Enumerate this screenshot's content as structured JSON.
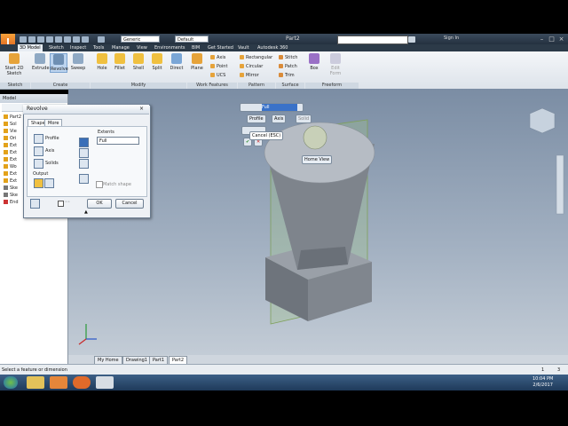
{
  "app": {
    "logo": "I",
    "doc_title": "Part2",
    "signin": "Sign In"
  },
  "quick_access": {
    "material": "Generic",
    "appearance": "Default"
  },
  "menu_tabs": [
    "3D Model",
    "Sketch",
    "Inspect",
    "Tools",
    "Manage",
    "View",
    "Environments",
    "BIM",
    "Get Started",
    "Vault",
    "Autodesk 360"
  ],
  "ribbon": {
    "start_sketch": "Start 2D Sketch",
    "create": [
      "Extrude",
      "Revolve",
      "Sweep"
    ],
    "modify": [
      "Hole",
      "Fillet",
      "Shell",
      "Split",
      "Direct"
    ],
    "plane": "Plane",
    "axis": "Axis",
    "point": "Point",
    "ucs": "UCS",
    "pattern": [
      "Rectangular",
      "Circular",
      "Mirror"
    ],
    "surface": [
      "Stitch",
      "Patch",
      "Trim"
    ],
    "box": "Box",
    "edit_form": "Edit Form",
    "panels": {
      "sketch": "Sketch",
      "create": "Create",
      "modify": "Modify",
      "work": "Work Features",
      "pattern": "Pattern",
      "surface": "Surface",
      "freeform": "Freeform"
    }
  },
  "browser": {
    "title": "Model",
    "items": [
      "Part2",
      "Sol",
      "Vie",
      "Ori",
      "Ext",
      "Ext",
      "Ext",
      "Wo",
      "Ext",
      "Ext",
      "Ske",
      "Ske",
      "End"
    ]
  },
  "dialog": {
    "title": "Revolve",
    "tabs": [
      "Shape",
      "More"
    ],
    "profile": "Profile",
    "axis": "Axis",
    "solids": "Solids",
    "output": "Output",
    "extents_label": "Extents",
    "extents_value": "Full",
    "match_shape": "Match shape",
    "ok": "OK",
    "cancel": "Cancel"
  },
  "minitoolbar": {
    "full": "Full",
    "profile": "Profile",
    "axis": "Axis",
    "solid": "Solid",
    "cancel": "Cancel (ESC)",
    "home": "Home View"
  },
  "doc_tabs": [
    "My Home",
    "Drawing1",
    "Part1",
    "Part2"
  ],
  "status": {
    "text": "Select a feature or dimension",
    "right1": "1",
    "right2": "3"
  },
  "clock": {
    "time": "10:04 PM",
    "date": "2/6/2017"
  },
  "colors": {
    "viewport_top": "#7b8da4",
    "ribbon": "#e8edf3",
    "accent": "#e3a21a"
  }
}
